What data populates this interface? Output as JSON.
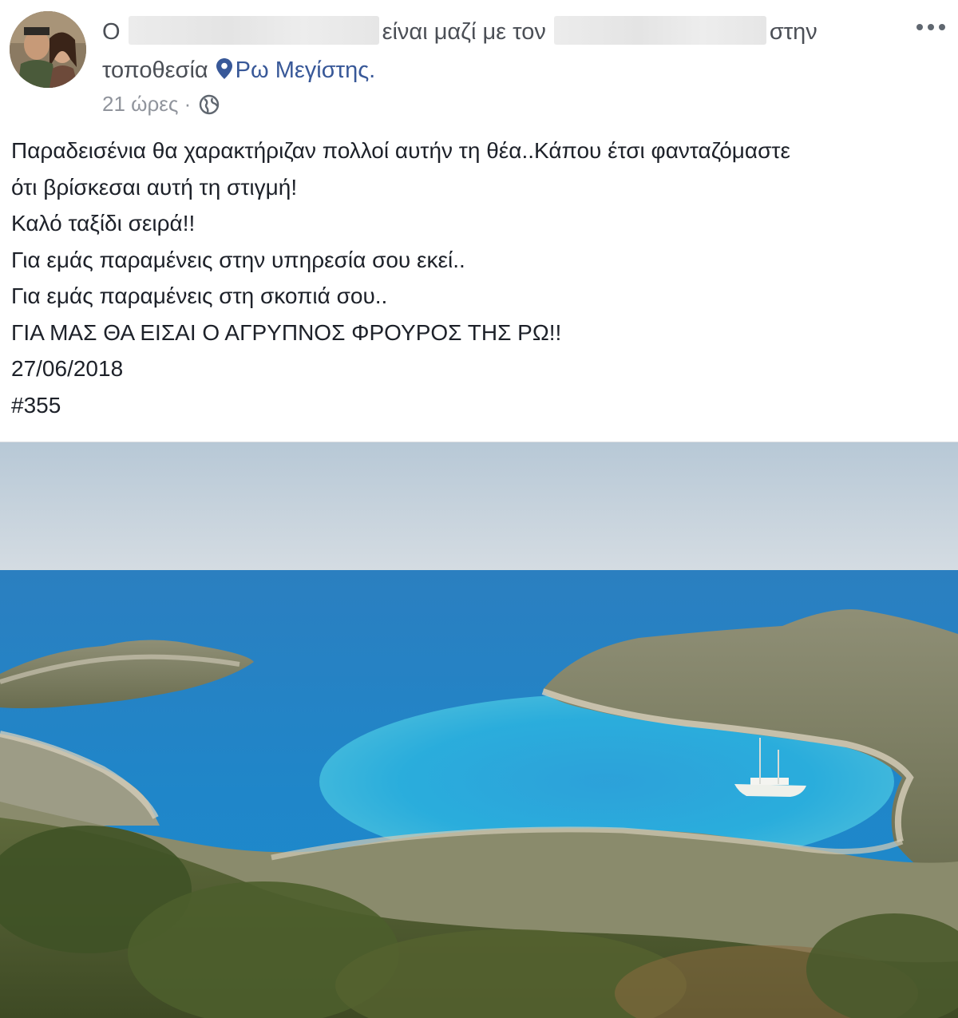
{
  "post": {
    "author_prefix": "Ο",
    "with_text": "είναι μαζί με τον",
    "at_text": "στην",
    "location_prefix": "τοποθεσία",
    "location_name": "Ρω Μεγίστης.",
    "time": "21 ώρες",
    "separator": "·",
    "privacy_icon": "globe-icon",
    "more_icon": "more-options-icon",
    "body_lines": [
      "Παραδεισένια θα χαρακτήριζαν πολλοί αυτήν τη θέα..Κάπου έτσι φανταζόμαστε",
      "ότι βρίσκεσαι αυτή τη στιγμή!",
      "Καλό ταξίδι σειρά!!",
      "Για εμάς παραμένεις στην υπηρεσία σου εκεί..",
      "Για εμάς παραμένεις στη σκοπιά σου..",
      "ΓΙΑ ΜΑΣ ΘΑ ΕΙΣΑΙ Ο ΑΓΡΥΠΝΟΣ ΦΡΟΥΡΟΣ ΤΗΣ ΡΩ!!",
      "27/06/2018",
      "#355"
    ]
  },
  "colors": {
    "link": "#385898",
    "meta": "#90949c",
    "text": "#1d2129",
    "sea": "#1e88c8",
    "lagoon": "#2fb0d8"
  }
}
